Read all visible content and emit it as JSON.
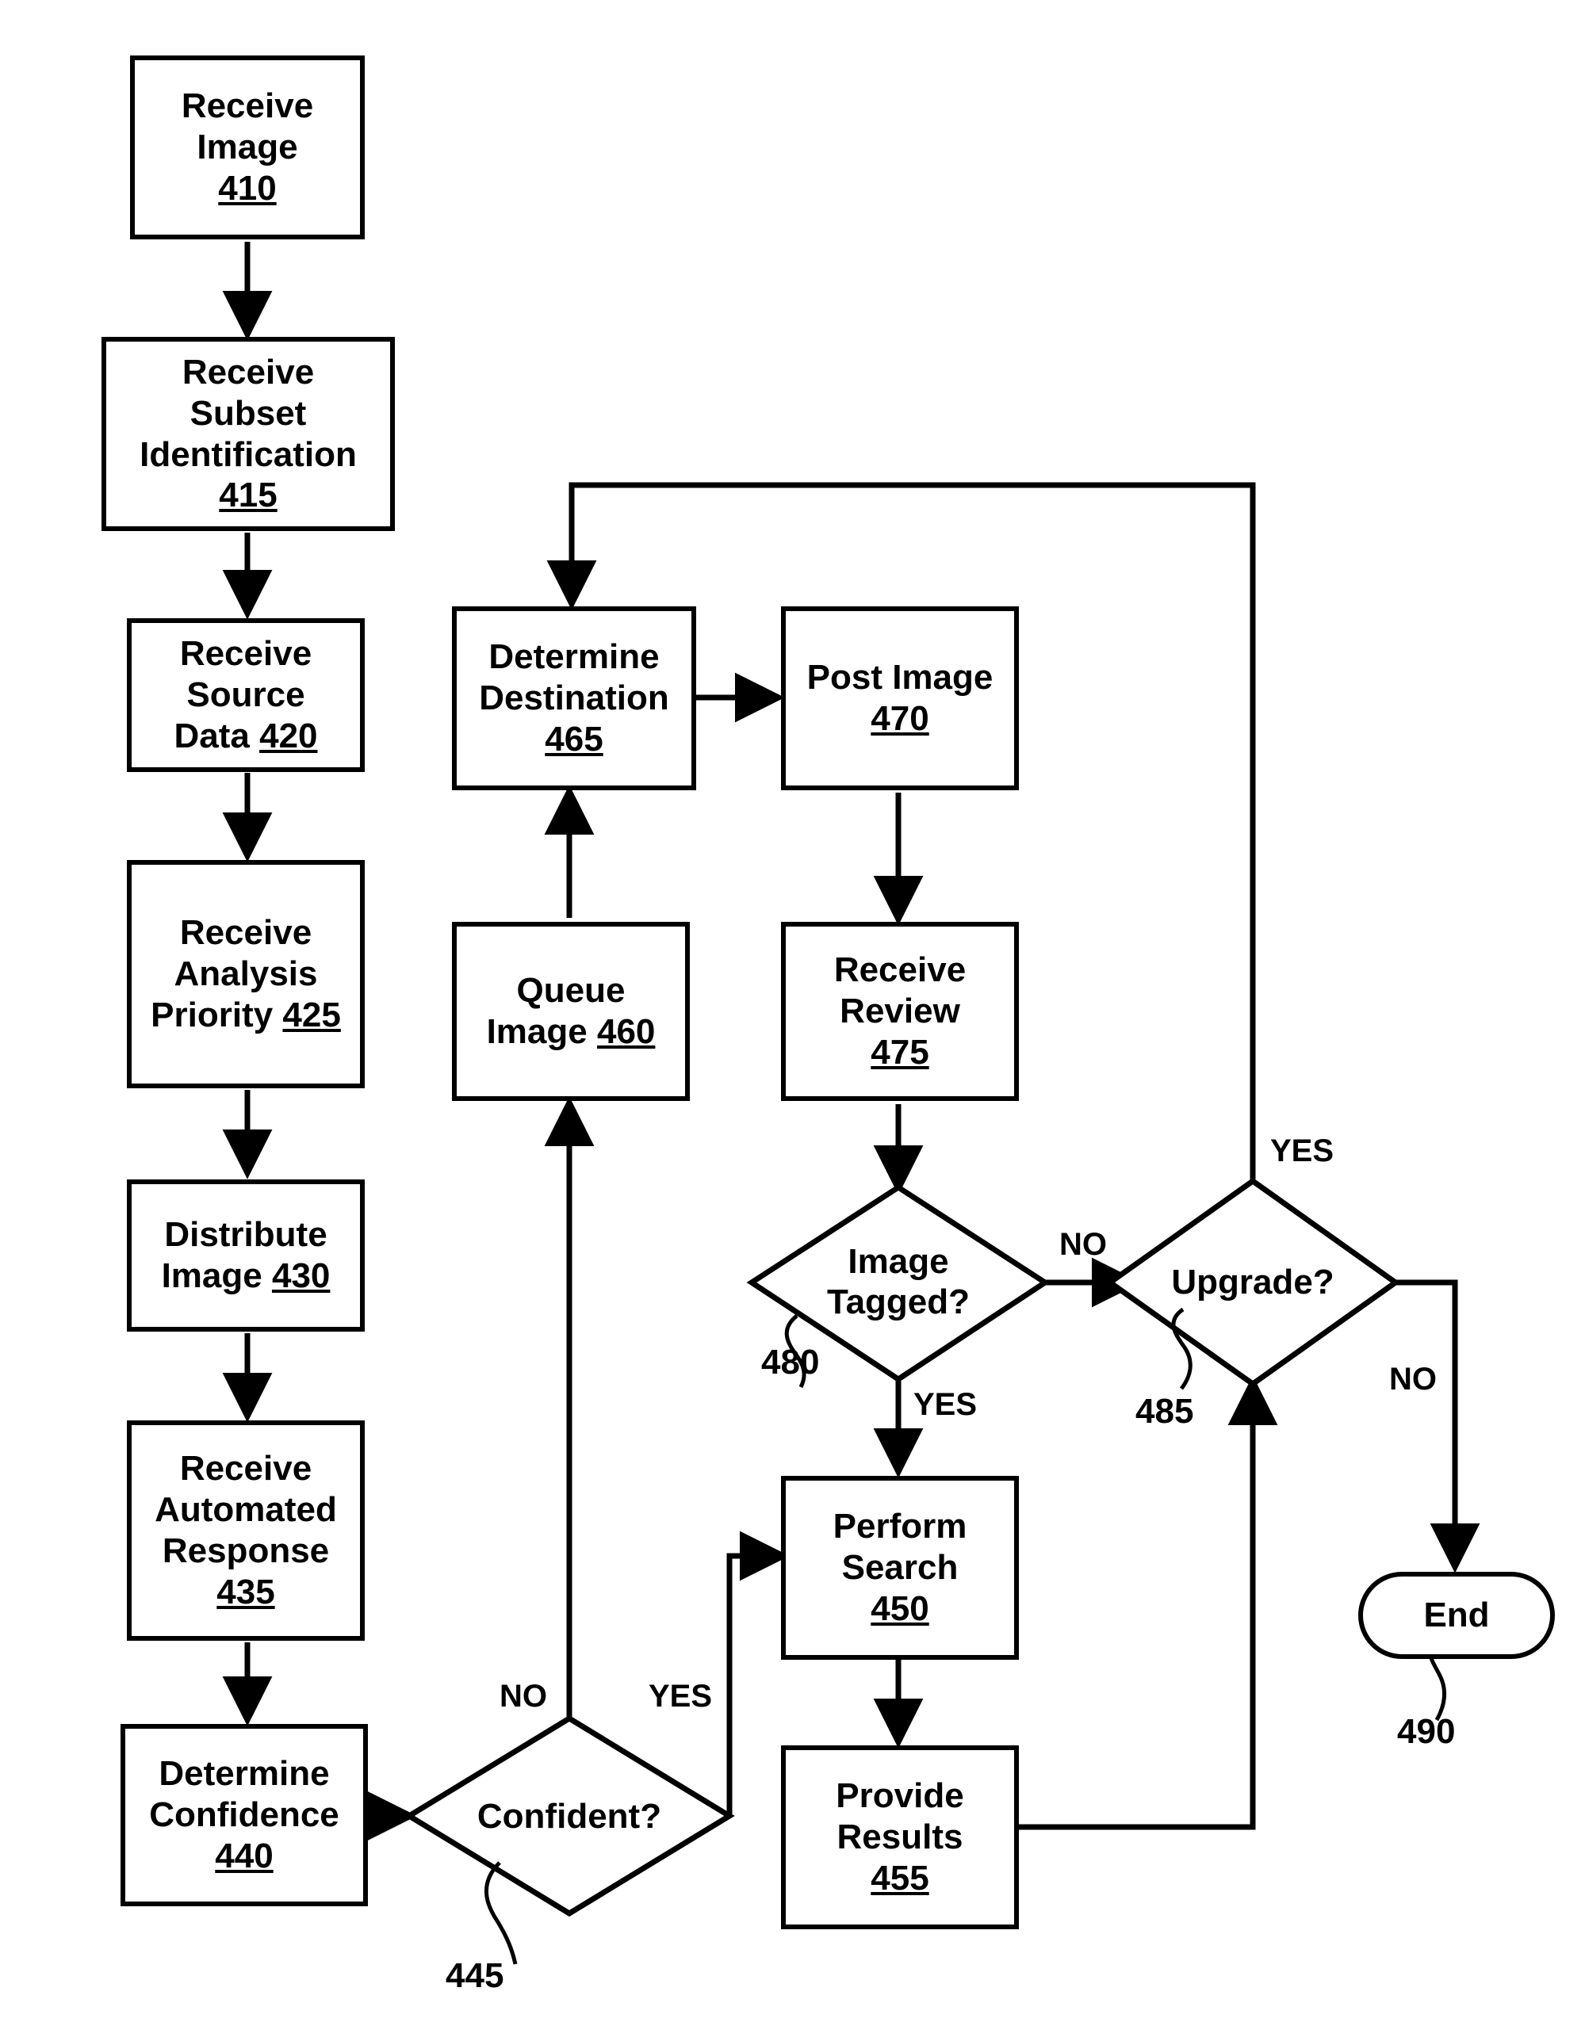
{
  "diagram": {
    "type": "flowchart",
    "title": "",
    "nodes": [
      {
        "id": "410",
        "shape": "process",
        "lines": [
          "Receive",
          "Image"
        ],
        "ref": "410"
      },
      {
        "id": "415",
        "shape": "process",
        "lines": [
          "Receive",
          "Subset",
          "Identification"
        ],
        "ref": "415"
      },
      {
        "id": "420",
        "shape": "process",
        "lines": [
          "Receive",
          "Source"
        ],
        "inline_line": "Data",
        "ref": "420"
      },
      {
        "id": "425",
        "shape": "process",
        "lines": [
          "Receive",
          "Analysis"
        ],
        "inline_line": "Priority",
        "ref": "425"
      },
      {
        "id": "430",
        "shape": "process",
        "lines": [
          "Distribute"
        ],
        "inline_line": "Image",
        "ref": "430"
      },
      {
        "id": "435",
        "shape": "process",
        "lines": [
          "Receive",
          "Automated",
          "Response"
        ],
        "ref": "435"
      },
      {
        "id": "440",
        "shape": "process",
        "lines": [
          "Determine",
          "Confidence"
        ],
        "ref": "440"
      },
      {
        "id": "445",
        "shape": "decision",
        "label": "Confident?",
        "ref": "445"
      },
      {
        "id": "450",
        "shape": "process",
        "lines": [
          "Perform",
          "Search"
        ],
        "ref": "450"
      },
      {
        "id": "455",
        "shape": "process",
        "lines": [
          "Provide",
          "Results"
        ],
        "ref": "455"
      },
      {
        "id": "460",
        "shape": "process",
        "lines": [
          "Queue"
        ],
        "inline_line": "Image",
        "ref": "460"
      },
      {
        "id": "465",
        "shape": "process",
        "lines": [
          "Determine",
          "Destination"
        ],
        "ref": "465"
      },
      {
        "id": "470",
        "shape": "process",
        "lines": [
          "Post Image"
        ],
        "ref": "470"
      },
      {
        "id": "475",
        "shape": "process",
        "lines": [
          "Receive",
          "Review"
        ],
        "ref": "475"
      },
      {
        "id": "480",
        "shape": "decision",
        "label_lines": [
          "Image",
          "Tagged?"
        ],
        "ref": "480"
      },
      {
        "id": "485",
        "shape": "decision",
        "label": "Upgrade?",
        "ref": "485"
      },
      {
        "id": "490",
        "shape": "terminator",
        "label": "End",
        "ref": "490"
      }
    ],
    "edge_labels": {
      "confident_no": "NO",
      "confident_yes": "YES",
      "tagged_no": "NO",
      "tagged_yes": "YES",
      "upgrade_yes": "YES",
      "upgrade_no": "NO"
    },
    "node_text": {
      "n410_l1": "Receive",
      "n410_l2": "Image",
      "n410_ref": "410",
      "n415_l1": "Receive",
      "n415_l2": "Subset",
      "n415_l3": "Identification",
      "n415_ref": "415",
      "n420_l1": "Receive",
      "n420_l2": "Source",
      "n420_l3": "Data",
      "n420_ref": "420",
      "n425_l1": "Receive",
      "n425_l2": "Analysis",
      "n425_l3": "Priority",
      "n425_ref": "425",
      "n430_l1": "Distribute",
      "n430_l2": "Image",
      "n430_ref": "430",
      "n435_l1": "Receive",
      "n435_l2": "Automated",
      "n435_l3": "Response",
      "n435_ref": "435",
      "n440_l1": "Determine",
      "n440_l2": "Confidence",
      "n440_ref": "440",
      "n445_label": "Confident?",
      "n445_ref": "445",
      "n450_l1": "Perform",
      "n450_l2": "Search",
      "n450_ref": "450",
      "n455_l1": "Provide",
      "n455_l2": "Results",
      "n455_ref": "455",
      "n460_l1": "Queue",
      "n460_l2": "Image",
      "n460_ref": "460",
      "n465_l1": "Determine",
      "n465_l2": "Destination",
      "n465_ref": "465",
      "n470_l1": "Post Image",
      "n470_ref": "470",
      "n475_l1": "Receive",
      "n475_l2": "Review",
      "n475_ref": "475",
      "n480_l1": "Image",
      "n480_l2": "Tagged?",
      "n480_ref": "480",
      "n485_label": "Upgrade?",
      "n485_ref": "485",
      "n490_label": "End",
      "n490_ref": "490"
    },
    "colors": {
      "stroke": "#000000",
      "fill": "#ffffff",
      "text": "#000000"
    }
  }
}
